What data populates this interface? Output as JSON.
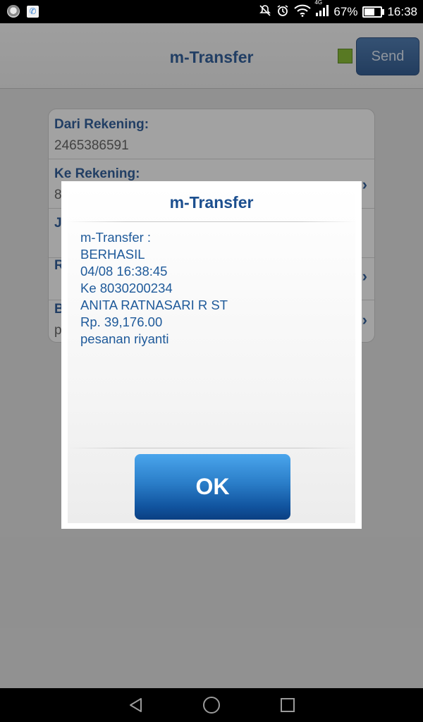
{
  "status_bar": {
    "battery_percent": "67%",
    "time": "16:38",
    "network_type": "4G",
    "battery_level": 0.67,
    "icons": [
      "app-icon",
      "phone-icon",
      "mute-icon",
      "alarm-icon",
      "wifi-icon",
      "signal-icon",
      "battery-icon"
    ]
  },
  "header": {
    "title": "m-Transfer",
    "send_label": "Send",
    "status_color": "#7ab320"
  },
  "form": {
    "rows": [
      {
        "label": "Dari Rekening:",
        "value": "2465386591"
      },
      {
        "label": "Ke Rekening:",
        "value": "8"
      },
      {
        "label": "J",
        "value": ""
      },
      {
        "label": "R",
        "value": ""
      },
      {
        "label": "B",
        "value": "p"
      }
    ]
  },
  "dialog": {
    "title": "m-Transfer",
    "lines": [
      "m-Transfer :",
      "BERHASIL",
      "04/08 16:38:45",
      "Ke 8030200234",
      "ANITA RATNASARI R ST",
      "Rp. 39,176.00",
      "pesanan riyanti"
    ],
    "ok_label": "OK"
  },
  "nav_bar": {
    "icons": [
      "back-icon",
      "home-icon",
      "recent-apps-icon"
    ]
  },
  "colors": {
    "accent": "#1c4f8f",
    "text_blue": "#1f5a9a"
  }
}
